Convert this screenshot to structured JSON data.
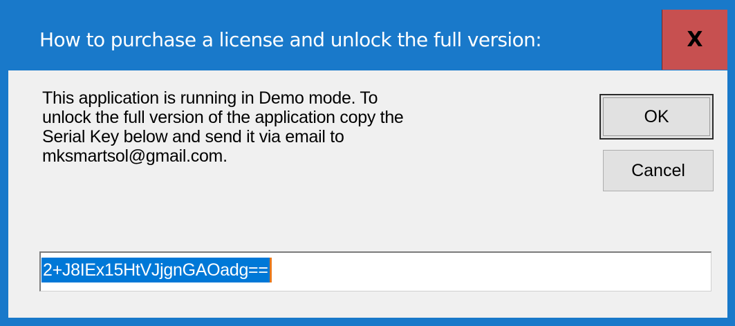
{
  "dialog": {
    "title": "How to purchase a license and unlock the full version:",
    "close_label": "X",
    "message_lines": [
      "This application is running in Demo mode. To",
      "unlock the full version of the application copy the",
      "Serial Key below and send it via email to",
      "mksmartsol@gmail.com."
    ],
    "ok_label": "OK",
    "cancel_label": "Cancel",
    "serial_key": "2+J8IEx15HtVJjgnGAOadg==",
    "colors": {
      "titlebar": "#1979ca",
      "close_button": "#c75050",
      "client_background": "#f0f0f0",
      "selection": "#0078d7"
    }
  }
}
